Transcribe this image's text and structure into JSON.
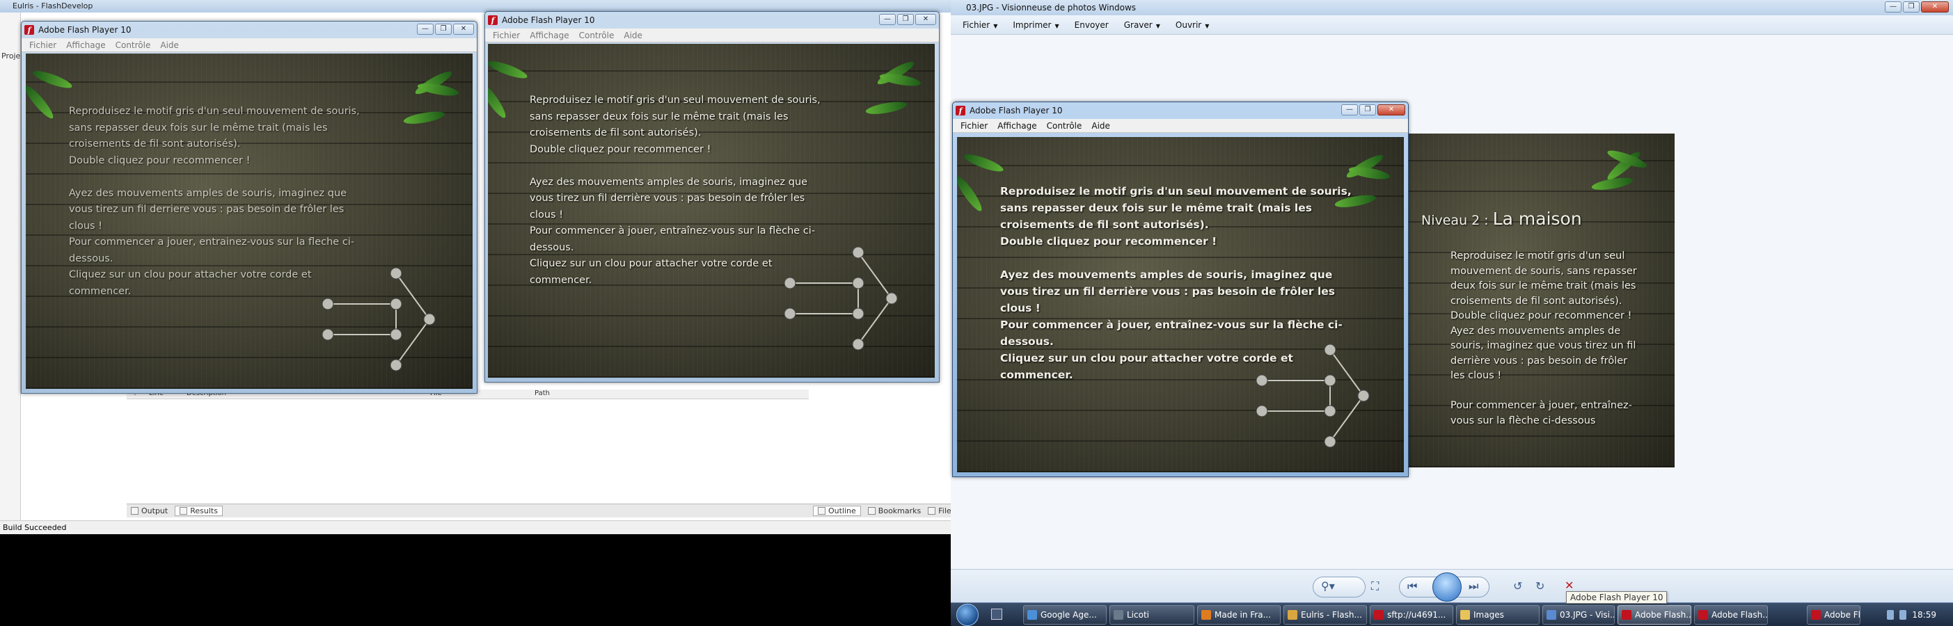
{
  "flashdevelop": {
    "title": "Eulris - FlashDevelop",
    "panel_label": "Proje",
    "results_columns": [
      "!",
      "Line",
      "Description",
      "File",
      "Path"
    ],
    "bottom_tabs": [
      "Output",
      "Results"
    ],
    "right_tabs": [
      "Outline",
      "Bookmarks",
      "Files"
    ],
    "status": "Build Succeeded"
  },
  "flash_window": {
    "title": "Adobe Flash Player 10",
    "menu": [
      "Fichier",
      "Affichage",
      "Contrôle",
      "Aide"
    ]
  },
  "instructions_a": "Reproduisez le motif gris d'un seul mouvement de souris,\nsans repasser deux fois sur le même trait (mais les\ncroisements de fil sont autorisés).\n Double cliquez pour recommencer !\n\nAyez des mouvements amples de souris, imaginez que\nvous tirez un fil derriere vous : pas besoin de frôler les\nclous !\nPour commencer a jouer, entrainez-vous sur la fleche ci-\ndessous.\nCliquez sur un clou pour attacher votre corde et\ncommencer.",
  "instructions_b": "Reproduisez le motif gris d'un seul mouvement de souris,\nsans repasser deux fois sur le même trait (mais les\ncroisements de fil sont autorisés).\n Double cliquez pour recommencer !\n\nAyez des mouvements amples de souris, imaginez que\nvous tirez un fil derrière vous : pas besoin de frôler les\nclous !\nPour commencer à jouer, entraînez-vous sur la flèche ci-\ndessous.\nCliquez sur un clou pour attacher votre corde et\ncommencer.",
  "photo_viewer": {
    "title": "03.JPG - Visionneuse de photos Windows",
    "menu": [
      "Fichier",
      "Imprimer",
      "Envoyer",
      "Graver",
      "Ouvrir"
    ],
    "level_prefix": "Niveau 2 : ",
    "level_name": "La maison",
    "photo_text": "Reproduisez le motif gris d'un seul\nmouvement de souris, sans repasser\ndeux fois sur le même trait (mais les\ncroisements de fil sont autorisés).\nDouble cliquez pour recommencer !\nAyez des mouvements amples de\nsouris, imaginez que vous tirez un fil\nderrière vous : pas besoin de frôler\nles clous !\n\nPour commencer à jouer, entraînez-\nvous sur la flèche ci-dessous"
  },
  "taskbar": {
    "items": [
      "Google Age...",
      "Licoti",
      "Made in Fra...",
      "Eulris - Flash...",
      "sftp://u4691...",
      "Images",
      "03.JPG - Visi...",
      "Adobe Flash...",
      "Adobe Flash...",
      "Adobe Flash..."
    ],
    "clock": "18:59",
    "tooltip": "Adobe Flash Player 10"
  },
  "colors": {
    "flash_icon": "#c1121f",
    "wood_dark": "#3f3e30",
    "taskbar": "#1c2a40"
  }
}
